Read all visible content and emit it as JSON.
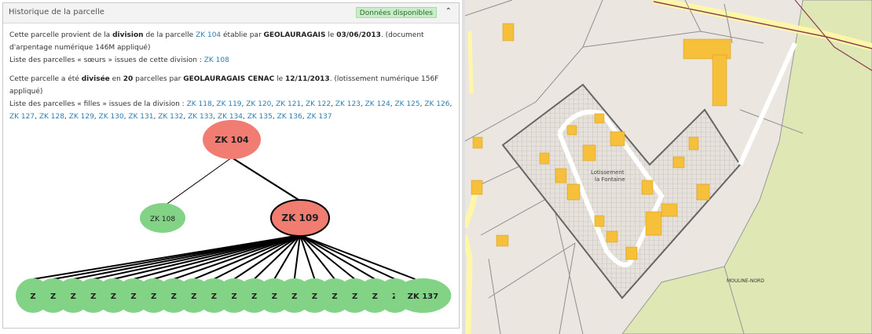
{
  "panel": {
    "title": "Historique de la parcelle",
    "badge": "Données disponibles",
    "collapse_icon": "chevron-up-icon"
  },
  "origin": {
    "t1": "Cette parcelle provient de la ",
    "t2": "division",
    "t3": " de la parcelle ",
    "parent_link": "ZK 104",
    "t4": " établie par ",
    "author": "GEOLAURAGAIS",
    "t5": " le ",
    "date": "03/06/2013",
    "t6": ". (document d'arpentage numérique 146M appliqué)",
    "siblings_label": "Liste des parcelles « sœurs » issues de cette division : ",
    "siblings": [
      "ZK 108"
    ]
  },
  "division": {
    "t1": "Cette parcelle a été ",
    "t2": "divisée",
    "t3": " en ",
    "count": "20",
    "t4": " parcelles par ",
    "author": "GEOLAURAGAIS CENAC",
    "t5": " le ",
    "date": "12/11/2013",
    "t6": ". (lotissement numérique 156F appliqué)",
    "children_label": "Liste des parcelles « filles » issues de la division : ",
    "children": [
      "ZK 118",
      "ZK 119",
      "ZK 120",
      "ZK 121",
      "ZK 122",
      "ZK 123",
      "ZK 124",
      "ZK 125",
      "ZK 126",
      "ZK 127",
      "ZK 128",
      "ZK 129",
      "ZK 130",
      "ZK 131",
      "ZK 132",
      "ZK 133",
      "ZK 134",
      "ZK 135",
      "ZK 136",
      "ZK 137"
    ]
  },
  "tree": {
    "root": "ZK 104",
    "sibling": "ZK 108",
    "current": "ZK 109",
    "leaf_labels": [
      "Z",
      "Z",
      "Z",
      "Z",
      "Z",
      "Z",
      "Z",
      "Z",
      "Z",
      "Z",
      "Z",
      "Z",
      "Z",
      "Z",
      "Z",
      "Z",
      "Z",
      "Z",
      "Z",
      "ZK 137"
    ],
    "colors": {
      "red": "#f07c72",
      "green": "#82d386",
      "edge": "#000000"
    }
  },
  "map": {
    "labels": {
      "lotissement_line1": "Lotissement",
      "lotissement_line2": "la Fontaine",
      "lieu_dit": "MOULINE-NORD"
    },
    "colors": {
      "background": "#ebe7e0",
      "field": "#dfe7b4",
      "building": "#f6c03b",
      "road": "#fff7a8",
      "parcel_line": "#7a7a7a"
    }
  }
}
